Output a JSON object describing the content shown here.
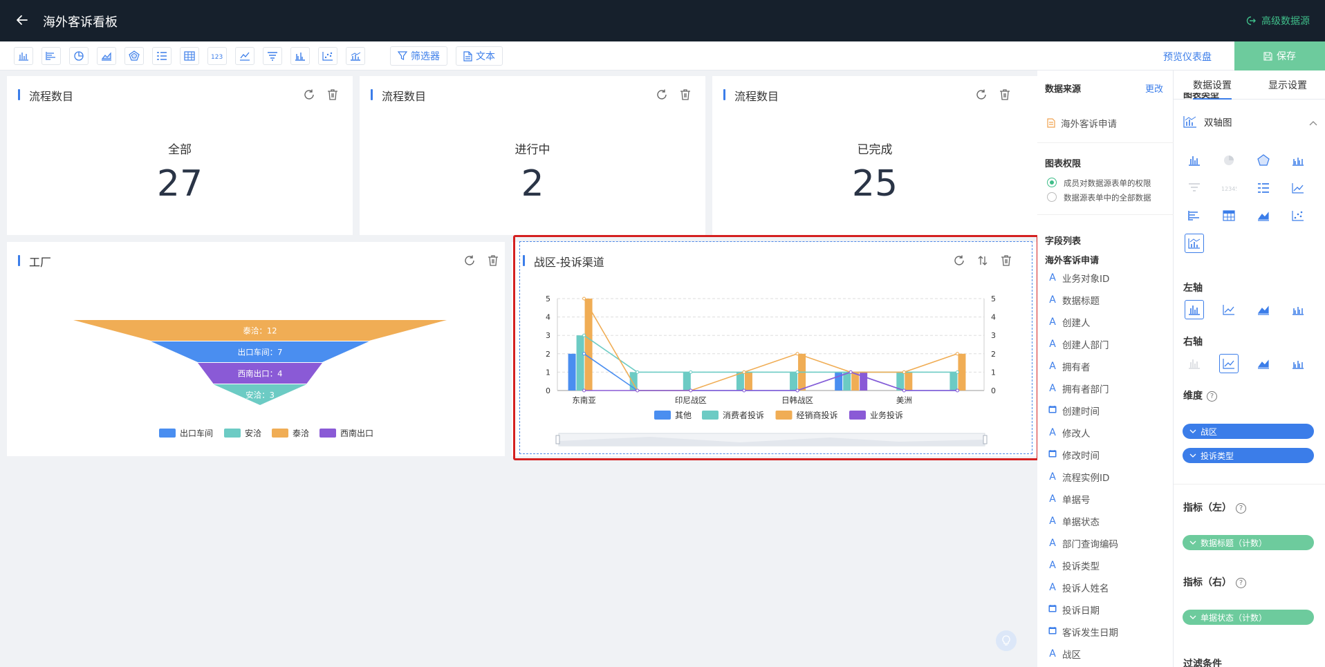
{
  "header": {
    "title": "海外客诉看板",
    "adv_source": "高级数据源"
  },
  "toolbar": {
    "filter_label": "筛选器",
    "text_label": "文本",
    "preview_label": "预览仪表盘",
    "save_label": "保存"
  },
  "cards": {
    "all": {
      "title": "流程数目",
      "label": "全部",
      "value": "27"
    },
    "progress": {
      "title": "流程数目",
      "label": "进行中",
      "value": "2"
    },
    "done": {
      "title": "流程数目",
      "label": "已完成",
      "value": "25"
    },
    "factory": {
      "title": "工厂"
    },
    "combo": {
      "title": "战区-投诉渠道"
    }
  },
  "funnel": {
    "stages": [
      {
        "label": "泰洽：12",
        "color": "#f0ad55"
      },
      {
        "label": "出口车间：7",
        "color": "#4a8ef0"
      },
      {
        "label": "西南出口：4",
        "color": "#8a5ad6"
      },
      {
        "label": "安洽：3",
        "color": "#6ccbc4"
      }
    ],
    "legend": [
      {
        "name": "出口车间",
        "color": "#4a8ef0"
      },
      {
        "name": "安洽",
        "color": "#6ccbc4"
      },
      {
        "name": "泰洽",
        "color": "#f0ad55"
      },
      {
        "name": "西南出口",
        "color": "#8a5ad6"
      }
    ]
  },
  "chart_data": [
    {
      "type": "funnel",
      "categories": [
        "泰洽",
        "出口车间",
        "西南出口",
        "安洽"
      ],
      "values": [
        12,
        7,
        4,
        3
      ]
    },
    {
      "type": "bar",
      "categories": [
        "东南亚",
        "",
        "印尼战区",
        "",
        "日韩战区",
        "",
        "美洲",
        ""
      ],
      "axis_labels": [
        "东南亚",
        "印尼战区",
        "日韩战区",
        "美洲"
      ],
      "ylim": [
        0,
        5
      ],
      "yticks": [
        "0",
        "1",
        "2",
        "3",
        "4",
        "5"
      ],
      "grid": true,
      "legend": "bottom",
      "series": [
        {
          "name": "其他",
          "color": "#4a8ef0",
          "values": [
            2,
            0,
            0,
            0,
            0,
            1,
            0,
            0
          ]
        },
        {
          "name": "消费者投诉",
          "color": "#6ccbc4",
          "values": [
            3,
            1,
            1,
            1,
            1,
            1,
            1,
            1
          ]
        },
        {
          "name": "经销商投诉",
          "color": "#f0ad55",
          "values": [
            5,
            0,
            0,
            1,
            2,
            1,
            1,
            2
          ]
        },
        {
          "name": "业务投诉",
          "color": "#8a5ad6",
          "values": [
            0,
            0,
            0,
            0,
            0,
            1,
            0,
            0
          ]
        }
      ],
      "lines": [
        {
          "name": "其他",
          "color": "#4a8ef0",
          "values": [
            2,
            0,
            0,
            0,
            0,
            1,
            0,
            0
          ]
        },
        {
          "name": "消费者投诉",
          "color": "#6ccbc4",
          "values": [
            3,
            1,
            1,
            1,
            1,
            1,
            1,
            1
          ]
        },
        {
          "name": "经销商投诉",
          "color": "#f0ad55",
          "values": [
            5,
            0,
            0,
            1,
            2,
            1,
            1,
            2
          ]
        },
        {
          "name": "业务投诉",
          "color": "#8a5ad6",
          "values": [
            0,
            0,
            0,
            0,
            0,
            1,
            0,
            0
          ]
        }
      ]
    }
  ],
  "fields": {
    "source_heading": "数据来源",
    "change": "更改",
    "source_name": "海外客诉申请",
    "perm_heading": "图表权限",
    "perm_options": [
      "成员对数据源表单的权限",
      "数据源表单中的全部数据"
    ],
    "list_heading": "字段列表",
    "form_name": "海外客诉申请",
    "items": [
      {
        "icon": "A",
        "label": "业务对象ID"
      },
      {
        "icon": "A",
        "label": "数据标题"
      },
      {
        "icon": "A",
        "label": "创建人"
      },
      {
        "icon": "A",
        "label": "创建人部门"
      },
      {
        "icon": "A",
        "label": "拥有者"
      },
      {
        "icon": "A",
        "label": "拥有者部门"
      },
      {
        "icon": "D",
        "label": "创建时间"
      },
      {
        "icon": "A",
        "label": "修改人"
      },
      {
        "icon": "D",
        "label": "修改时间"
      },
      {
        "icon": "A",
        "label": "流程实例ID"
      },
      {
        "icon": "A",
        "label": "单据号"
      },
      {
        "icon": "A",
        "label": "单据状态"
      },
      {
        "icon": "A",
        "label": "部门查询编码"
      },
      {
        "icon": "A",
        "label": "投诉类型"
      },
      {
        "icon": "A",
        "label": "投诉人姓名"
      },
      {
        "icon": "D",
        "label": "投诉日期"
      },
      {
        "icon": "D",
        "label": "客诉发生日期"
      },
      {
        "icon": "A",
        "label": "战区"
      }
    ]
  },
  "settings": {
    "tab_data": "数据设置",
    "tab_display": "显示设置",
    "chart_type_heading": "图表类型",
    "chart_type": "双轴图",
    "left_axis": "左轴",
    "right_axis": "右轴",
    "dimension": "维度",
    "dimensions": [
      "战区",
      "投诉类型"
    ],
    "metric_left": "指标（左）",
    "metric_left_value": "数据标题（计数）",
    "metric_right": "指标（右）",
    "metric_right_value": "单据状态（计数）",
    "filter": "过滤条件"
  }
}
